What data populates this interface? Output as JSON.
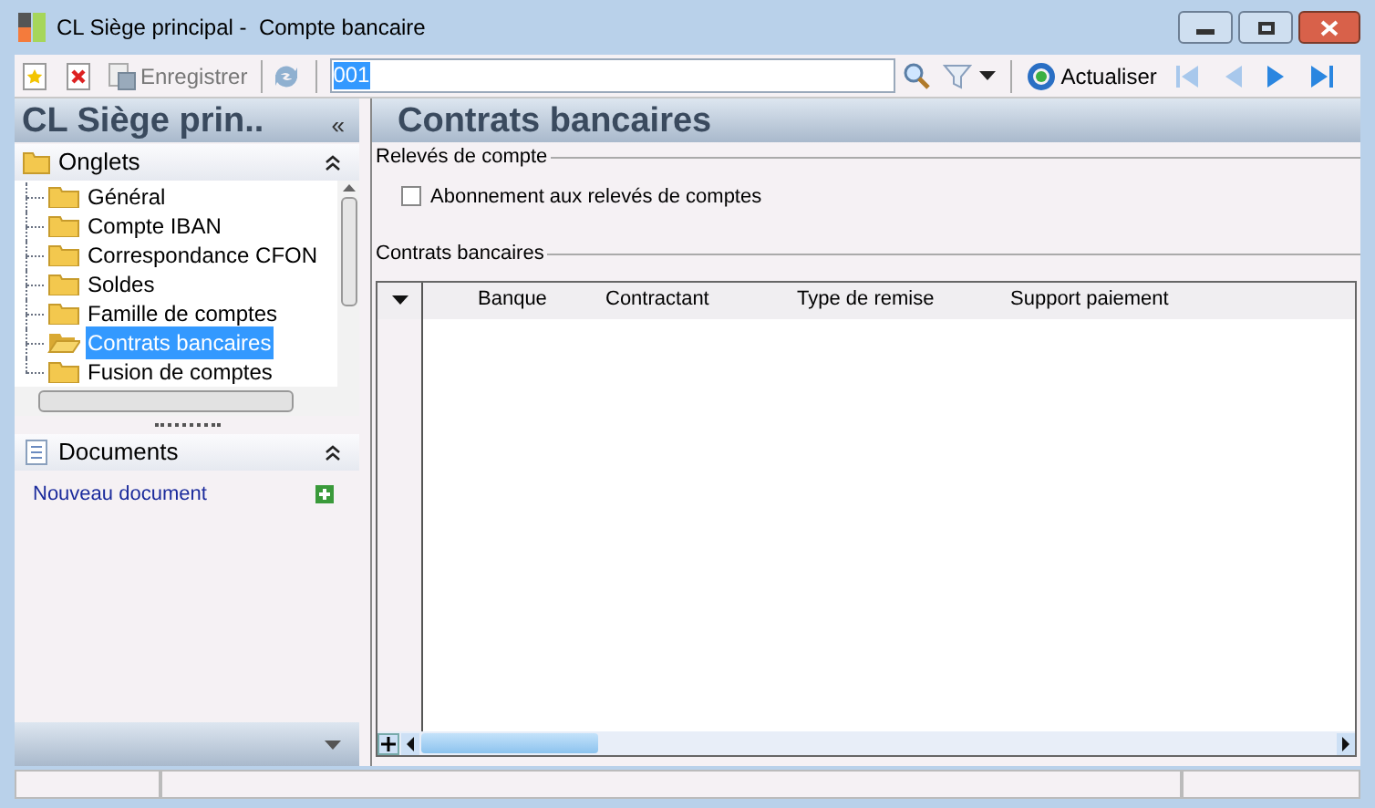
{
  "window": {
    "title": "CL Siège principal -  Compte bancaire"
  },
  "toolbar": {
    "save_label": "Enregistrer",
    "search_value": "001",
    "refresh_label": "Actualiser"
  },
  "sidebar": {
    "header": "CL Siège prin..",
    "collapse": "«",
    "tabs_section": {
      "title": "Onglets",
      "expanded": true,
      "items": [
        {
          "label": "Général",
          "selected": false
        },
        {
          "label": "Compte IBAN",
          "selected": false
        },
        {
          "label": "Correspondance CFON",
          "selected": false
        },
        {
          "label": "Soldes",
          "selected": false
        },
        {
          "label": "Famille de comptes",
          "selected": false
        },
        {
          "label": "Contrats bancaires",
          "selected": true
        },
        {
          "label": "Fusion de comptes",
          "selected": false
        }
      ]
    },
    "documents_section": {
      "title": "Documents",
      "expanded": true,
      "link": "Nouveau document"
    }
  },
  "main": {
    "header": "Contrats bancaires",
    "statements_group": {
      "title": "Relevés de compte",
      "checkbox": {
        "label": "Abonnement aux relevés de comptes",
        "checked": false
      }
    },
    "contracts_group": {
      "title": "Contrats bancaires",
      "columns": [
        "Banque",
        "Contractant",
        "Type de remise",
        "Support paiement"
      ]
    }
  }
}
